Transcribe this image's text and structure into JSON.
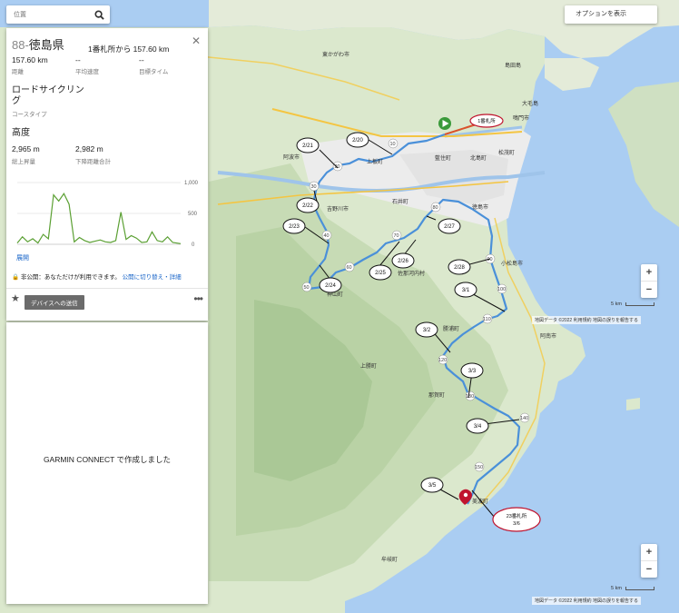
{
  "search": {
    "placeholder": "位置",
    "icon": "search-icon"
  },
  "options_button": {
    "label": "オプションを表示"
  },
  "panel": {
    "number": "88-",
    "title": "徳島県",
    "close_icon": "close-icon",
    "from": "1番札所から 157.60 km",
    "stats": [
      {
        "value": "157.60 km",
        "label": "距離"
      },
      {
        "value": "--",
        "label": "平均速度"
      },
      {
        "value": "--",
        "label": "目標タイム"
      }
    ],
    "course_type": "ロードサイクリング",
    "course_type_label": "コースタイプ",
    "elevation_title": "高度",
    "elevation": [
      {
        "value": "2,965 m",
        "label": "総上昇量"
      },
      {
        "value": "2,982 m",
        "label": "下降距離合計"
      }
    ],
    "chart_ticks": [
      "1,000",
      "500",
      "0"
    ],
    "expand": "展開",
    "privacy_text": "非公開：あなただけが利用できます。",
    "privacy_link": "公開に切り替え・詳細",
    "send_button": "デバイスへの送信",
    "more_icon": "more-icon",
    "star_icon": "star-icon"
  },
  "note": "GARMIN CONNECT で作成しました",
  "map": {
    "start_label": "1番札所",
    "end_label_line1": "23番札所",
    "end_label_line2": "3/6",
    "days": [
      "2/20",
      "2/21",
      "2/22",
      "2/23",
      "2/24",
      "2/25",
      "2/26",
      "2/27",
      "2/28",
      "3/1",
      "3/2",
      "3/3",
      "3/4",
      "3/5"
    ],
    "places": [
      "鳴門市",
      "島田島",
      "大毛島",
      "東かがわ市",
      "阿波市",
      "上板町",
      "藍住町",
      "北島町",
      "松茂町",
      "石井町",
      "吉野川市",
      "徳島市",
      "小松島市",
      "佐那河内村",
      "神山町",
      "勝浦町",
      "上勝町",
      "那賀町",
      "阿南市",
      "美波町",
      "牟岐町"
    ],
    "route_numbers": [
      "11",
      "10",
      "20",
      "30",
      "40",
      "50",
      "60",
      "70",
      "80",
      "90",
      "100",
      "110",
      "120",
      "130",
      "140",
      "150"
    ],
    "scale_label": "5 km",
    "attribution": [
      "地図データ ©2022",
      "利用規約",
      "地図の誤りを報告する"
    ]
  },
  "zoom": {
    "in": "+",
    "out": "−"
  },
  "colors": {
    "route": "#3d8ee0",
    "start": "#3a9a3a",
    "end": "#c0142e",
    "sea": "#a9cdf2",
    "link": "#1a66c9"
  },
  "chart_data": {
    "type": "area",
    "x": [
      0,
      5,
      10,
      15,
      20,
      25,
      30,
      35,
      40,
      45,
      50,
      55,
      60,
      65,
      70,
      75,
      80,
      85,
      90,
      95,
      100,
      105,
      110,
      115,
      120,
      125,
      130,
      135,
      140,
      145,
      150,
      157.6
    ],
    "values": [
      20,
      120,
      40,
      90,
      20,
      160,
      90,
      800,
      700,
      820,
      650,
      40,
      110,
      60,
      30,
      50,
      70,
      40,
      30,
      60,
      520,
      80,
      140,
      100,
      30,
      40,
      200,
      60,
      40,
      120,
      30,
      10
    ],
    "ylim": [
      0,
      1000
    ],
    "yticks": [
      0,
      500,
      1000
    ]
  }
}
